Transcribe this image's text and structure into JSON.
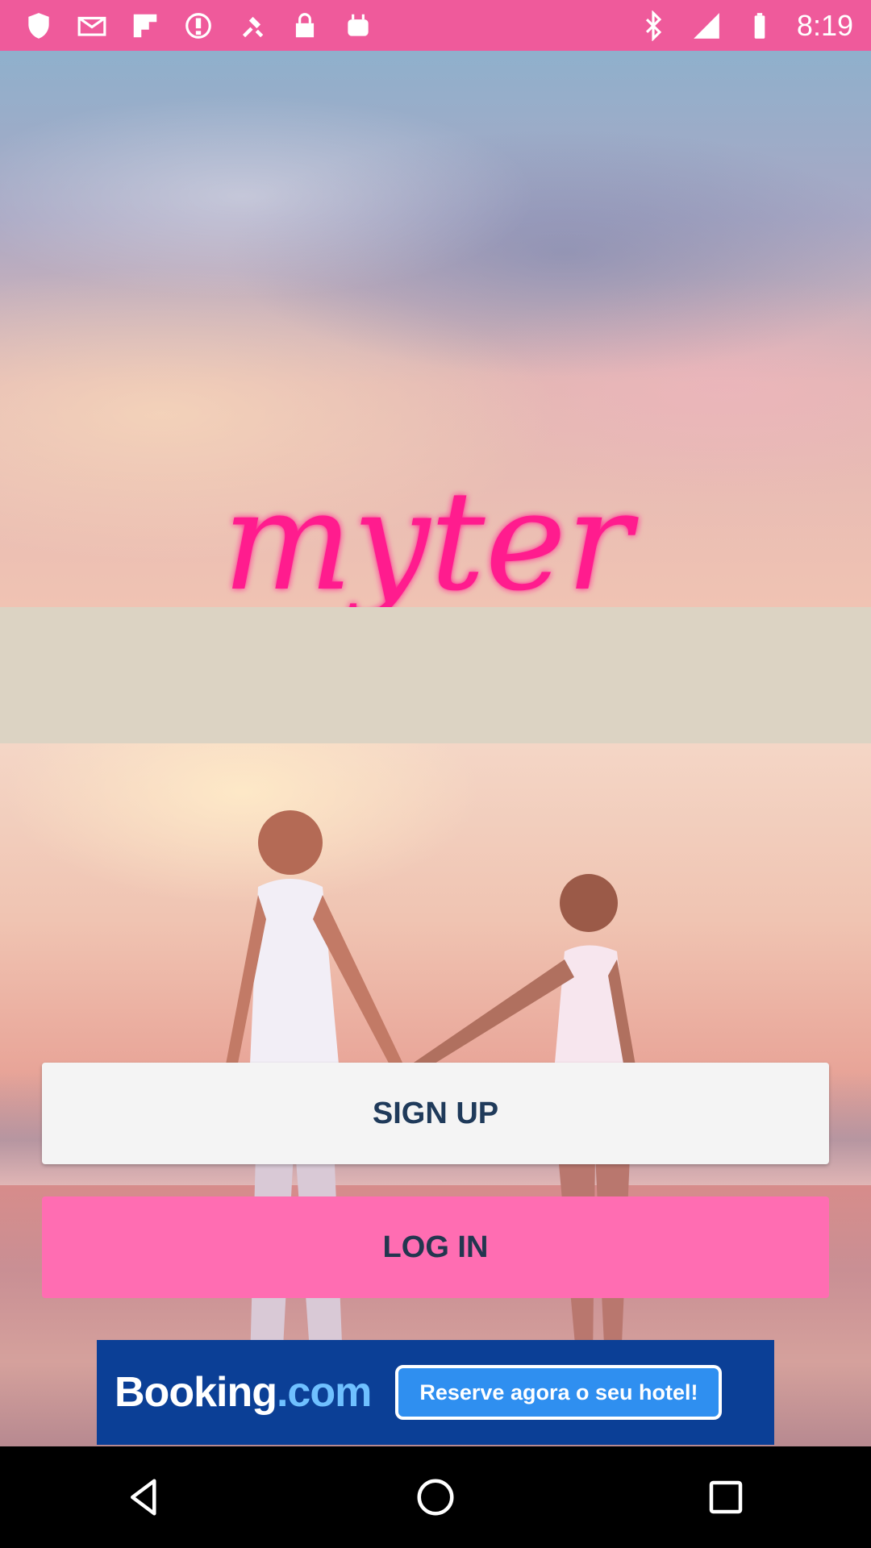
{
  "status_bar": {
    "time": "8:19",
    "left_icons": [
      "shield-icon",
      "mail-icon",
      "flipboard-icon",
      "alert-icon",
      "fake-gps-icon",
      "lock-icon",
      "android-icon"
    ],
    "right_icons": [
      "bluetooth-icon",
      "signal-icon",
      "battery-icon"
    ],
    "color": "#ef5a9b"
  },
  "app": {
    "logo_text": "myter",
    "logo_color": "#ff1f8e"
  },
  "buttons": {
    "signup_label": "SIGN UP",
    "login_label": "LOG IN",
    "login_color": "#ff6db2"
  },
  "ad": {
    "brand": "Booking",
    "brand_suffix": ".com",
    "cta": "Reserve agora o seu hotel!",
    "background": "#0b3f96"
  },
  "nav_bar": {
    "icons": [
      "back-icon",
      "home-icon",
      "recents-icon"
    ]
  }
}
